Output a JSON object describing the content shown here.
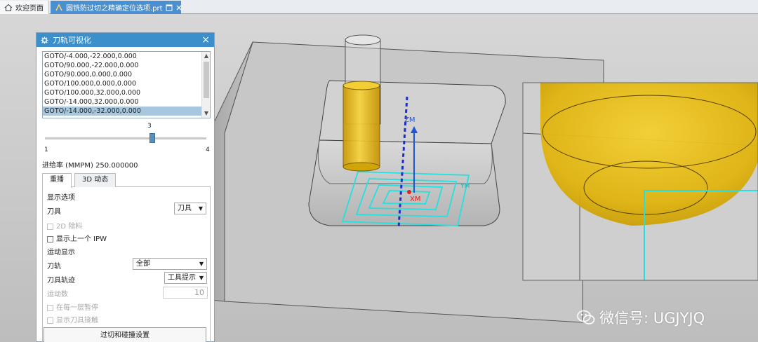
{
  "tabs": {
    "home_label": "欢迎页面",
    "file_label": "圆铣防过切之精确定位选项.prt"
  },
  "panel": {
    "title": "刀轨可视化",
    "close": "×",
    "list_items": [
      "GOTO/-4.000,-22.000,0.000",
      "GOTO/90.000,-22.000,0.000",
      "GOTO/90.000,0.000,0.000",
      "GOTO/100.000,0.000,0.000",
      "GOTO/100.000,32.000,0.000",
      "GOTO/-14.000,32.000,0.000",
      "GOTO/-14.000,-32.000,0.000"
    ],
    "selected_index": 6,
    "slider": {
      "min": "1",
      "max": "4",
      "value": "3",
      "position_fraction": 0.667
    },
    "feedrate": "进给率 (MMPM) 250.000000",
    "tab_replay": "重播",
    "tab_3d": "3D 动态",
    "display_options_heading": "显示选项",
    "tool_label": "刀具",
    "tool_value": "刀具",
    "blank_2d_label": "2D 除料",
    "show_prev_ipw_label": "显示上一个 IPW",
    "motion_display_heading": "运动显示",
    "toolpath_label": "刀轨",
    "toolpath_value": "全部",
    "tool_trace_label": "刀具轨迹",
    "tool_trace_value": "工具提示",
    "motion_count_label": "运动数",
    "motion_count_value": "10",
    "pause_each_layer_label": "在每一层暂停",
    "show_tool_contact_label": "显示刀具接触",
    "gouge_button": "过切和碰撞设置"
  },
  "viewport": {
    "axis_z": "ZM",
    "axis_x": "XM",
    "axis_y": "YM"
  },
  "watermark": "微信号: UGJYJQ",
  "colors": {
    "accent": "#3b8fcb",
    "tool_yellow": "#e6b800",
    "toolpath_cyan": "#25e0e0",
    "part_gray": "#b9b9b9"
  }
}
